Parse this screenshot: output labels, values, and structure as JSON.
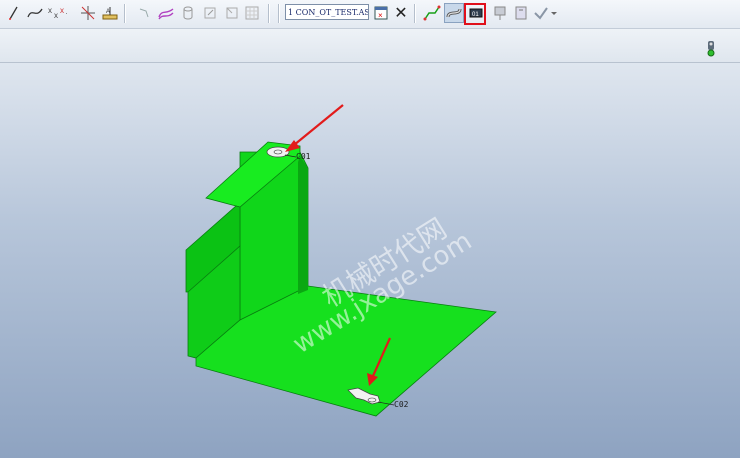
{
  "toolbar": {
    "model_name": "1 CON_OT_TEST.ASM",
    "close_symbol": "✕"
  },
  "icons": [
    "sketch-line-icon",
    "spline-icon",
    "point-icon",
    "csys-icon",
    "datum-plane-icon",
    "cable-route-icon",
    "harness-icon",
    "cylinder-icon",
    "flag-icon",
    "window-icon",
    "grid-icon",
    "model-window-icon",
    "close-icon",
    "route-path-icon",
    "cable-tool-icon",
    "network-icon",
    "tool-icon",
    "connector-icon",
    "check-icon",
    "traffic-light-icon"
  ],
  "viewport": {
    "connectors": [
      {
        "label": "C01"
      },
      {
        "label": "C02"
      }
    ],
    "watermark_line1": "机械时代网",
    "watermark_line2": "www.jxage.com"
  },
  "colors": {
    "part": "#14e51a",
    "part_dark": "#0aa812",
    "arrow": "#e21b1b",
    "highlight": "#e0101b"
  }
}
